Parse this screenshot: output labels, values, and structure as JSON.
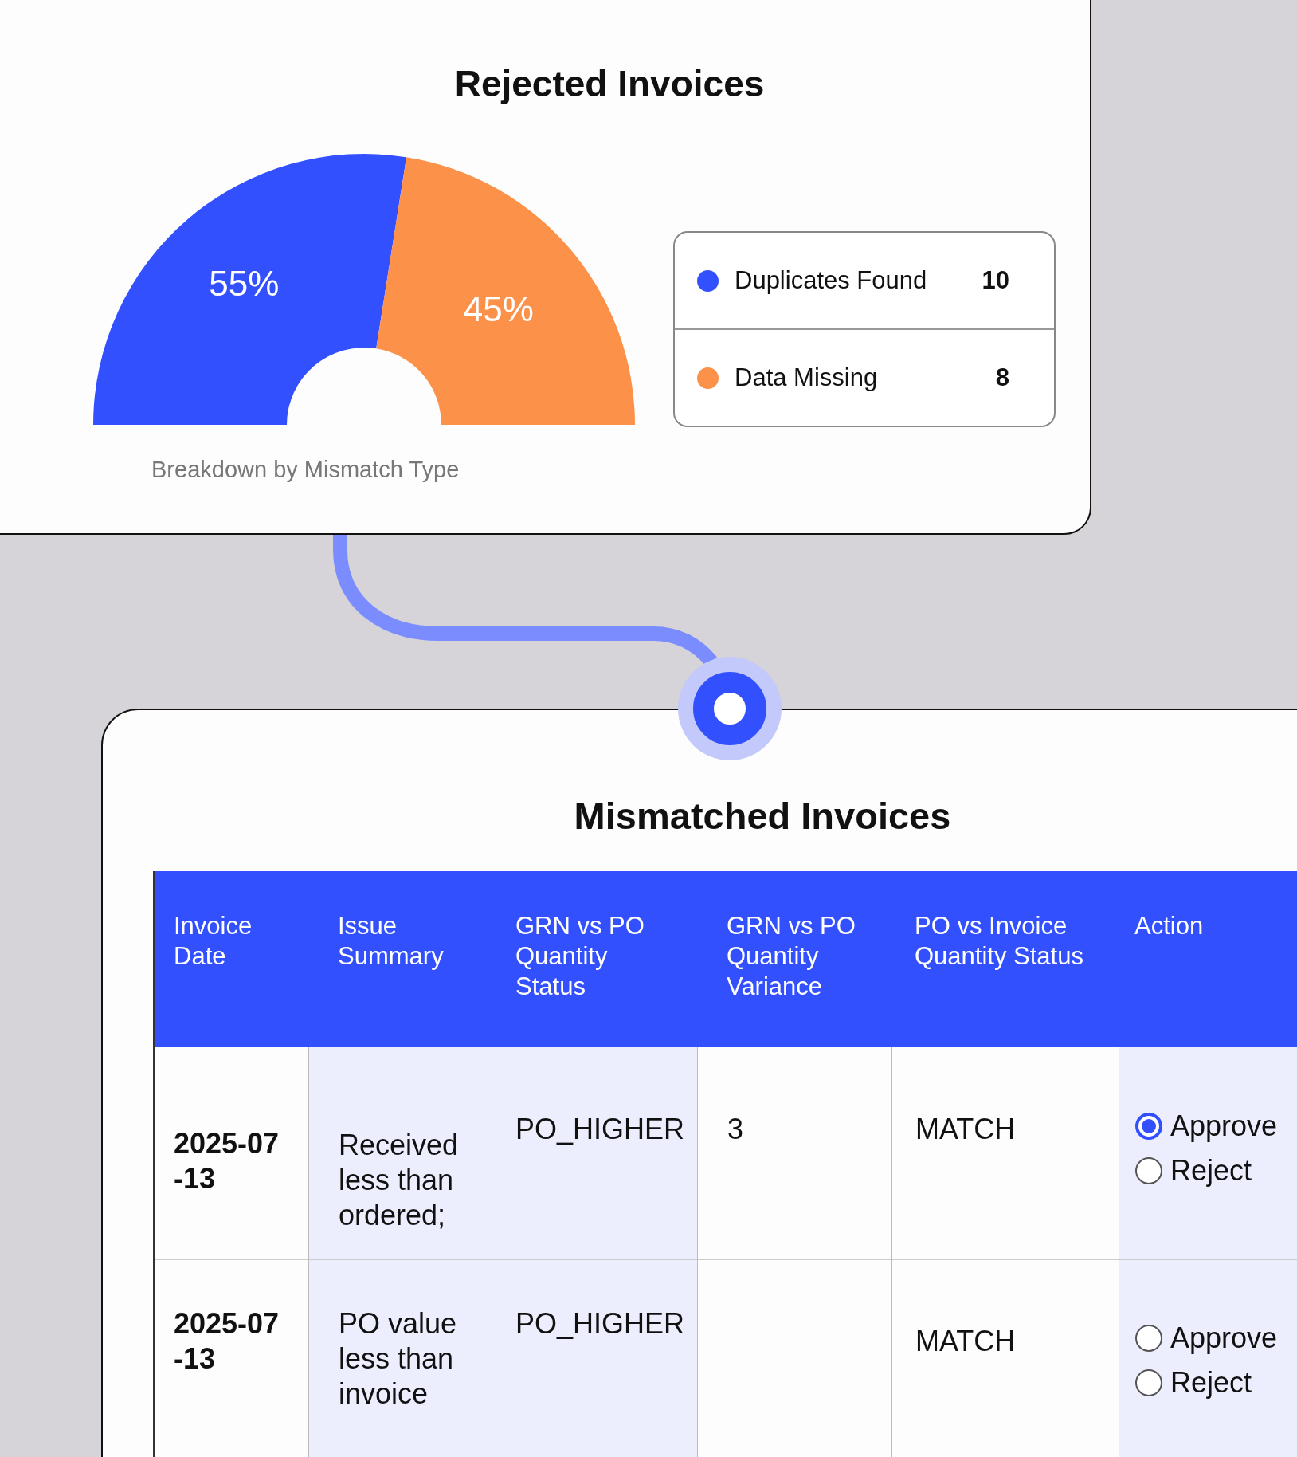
{
  "rejected_card": {
    "title": "Rejected Invoices",
    "chart_data": {
      "type": "donut",
      "categories": [
        "Duplicates Found",
        "Data Missing"
      ],
      "values": [
        55,
        45
      ],
      "value_labels": [
        "55%",
        "45%"
      ]
    },
    "caption": "Breakdown by Mismatch Type",
    "legend": [
      {
        "count": "10",
        "color": "#3350ff"
      },
      {
        "count": "8",
        "color": "#fc914a"
      }
    ]
  },
  "mismatch_card": {
    "title": "Mismatched Invoices",
    "table": {
      "columns": [
        "Invoice Date",
        "Issue Summary",
        "GRN vs PO Quantity Status",
        "GRN vs PO Quantity Variance",
        "PO vs Invoice Quantity Status",
        "Action"
      ],
      "rows": [
        {
          "invoice_date": "2025-07-13",
          "issue_summary": "Received less than ordered;",
          "grn_po_status": "PO_HIGHER",
          "grn_po_variance": "3",
          "po_invoice_status": "MATCH",
          "action": [
            {
              "label": "Approve",
              "selected": true
            },
            {
              "label": "Reject",
              "selected": false
            }
          ]
        },
        {
          "invoice_date": "2025-07-13",
          "issue_summary": "PO value less than invoice",
          "grn_po_status": "PO_HIGHER",
          "po_invoice_status": "MATCH",
          "action": [
            {
              "label": "Approve",
              "selected": false
            },
            {
              "label": "Reject",
              "selected": false
            }
          ]
        }
      ]
    }
  }
}
